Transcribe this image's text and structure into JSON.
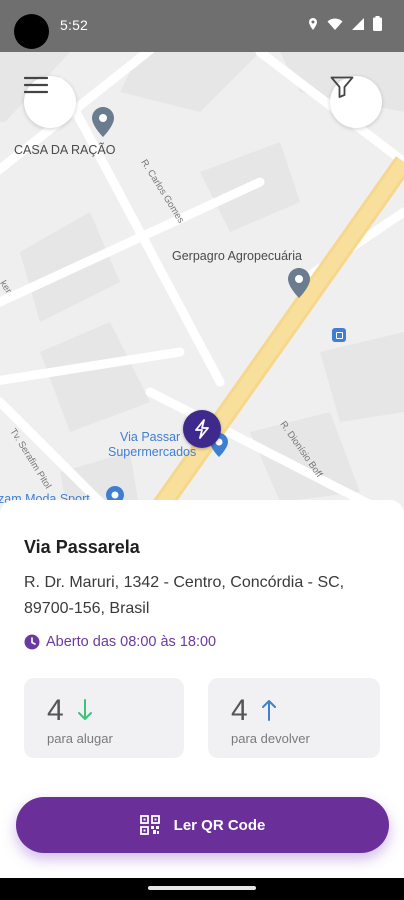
{
  "status_bar": {
    "time": "5:52"
  },
  "map": {
    "labels": {
      "poi_casa": "CASA DA RAÇÃO",
      "poi_gerpagro": "Gerpagro Agropecuária",
      "poi_via_passarela_1": "Via Passar",
      "poi_via_passarela_2": "Supermercados",
      "poi_moda": "zam Moda Sport",
      "street_carlos_gomes": "R. Carlos Gomes",
      "street_dionisio": "R. Dionísio Boff",
      "street_serafim": "Tv. Serafim Pitol",
      "street_ker": "ker"
    }
  },
  "sheet": {
    "place_name": "Via Passarela",
    "address": "R. Dr. Maruri, 1342 - Centro, Concórdia - SC, 89700-156, Brasil",
    "hours": "Aberto das 08:00 às 18:00",
    "rent": {
      "count": "4",
      "caption": "para alugar"
    },
    "return": {
      "count": "4",
      "caption": "para devolver"
    },
    "qr_button_label": "Ler QR Code"
  },
  "colors": {
    "accent": "#6b2f9a",
    "pin": "#3e2a8c",
    "rent_arrow": "#39c47a",
    "return_arrow": "#3f7fd3"
  }
}
